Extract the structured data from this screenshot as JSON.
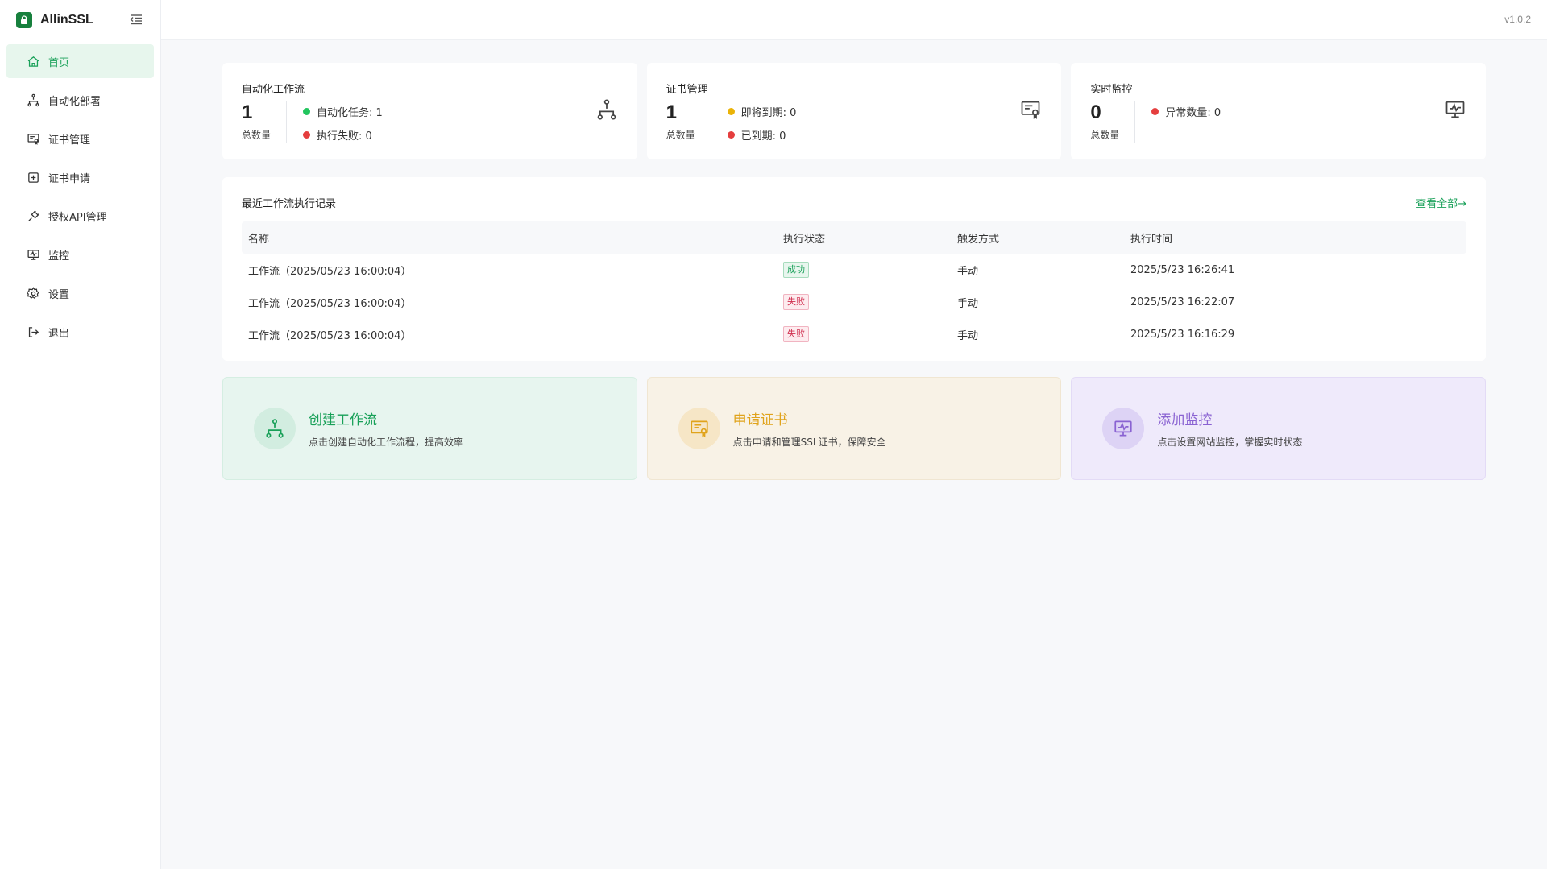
{
  "app": {
    "name": "AllinSSL",
    "version": "v1.0.2"
  },
  "sidebar": {
    "items": [
      {
        "label": "首页",
        "icon": "home-icon",
        "active": true
      },
      {
        "label": "自动化部署",
        "icon": "workflow-icon"
      },
      {
        "label": "证书管理",
        "icon": "certificate-icon"
      },
      {
        "label": "证书申请",
        "icon": "plus-square-icon"
      },
      {
        "label": "授权API管理",
        "icon": "api-plug-icon"
      },
      {
        "label": "监控",
        "icon": "monitor-icon"
      },
      {
        "label": "设置",
        "icon": "gear-icon"
      },
      {
        "label": "退出",
        "icon": "logout-icon"
      }
    ]
  },
  "stats": {
    "workflow": {
      "title": "自动化工作流",
      "count": "1",
      "count_label": "总数量",
      "items": [
        {
          "label": "自动化任务: 1",
          "color": "#22c55e"
        },
        {
          "label": "执行失败: 0",
          "color": "#e53e3e"
        }
      ]
    },
    "cert": {
      "title": "证书管理",
      "count": "1",
      "count_label": "总数量",
      "items": [
        {
          "label": "即将到期: 0",
          "color": "#eab308"
        },
        {
          "label": "已到期: 0",
          "color": "#e53e3e"
        }
      ]
    },
    "monitor": {
      "title": "实时监控",
      "count": "0",
      "count_label": "总数量",
      "items": [
        {
          "label": "异常数量: 0",
          "color": "#e53e3e"
        }
      ]
    }
  },
  "records": {
    "title": "最近工作流执行记录",
    "view_all": "查看全部→",
    "columns": [
      "名称",
      "执行状态",
      "触发方式",
      "执行时间"
    ],
    "rows": [
      {
        "name": "工作流（2025/05/23 16:00:04）",
        "status": "成功",
        "status_type": "success",
        "trigger": "手动",
        "time": "2025/5/23 16:26:41"
      },
      {
        "name": "工作流（2025/05/23 16:00:04）",
        "status": "失败",
        "status_type": "fail",
        "trigger": "手动",
        "time": "2025/5/23 16:22:07"
      },
      {
        "name": "工作流（2025/05/23 16:00:04）",
        "status": "失败",
        "status_type": "fail",
        "trigger": "手动",
        "time": "2025/5/23 16:16:29"
      }
    ]
  },
  "actions": [
    {
      "title": "创建工作流",
      "desc": "点击创建自动化工作流程，提高效率",
      "icon": "workflow-icon",
      "color": "#18a058"
    },
    {
      "title": "申请证书",
      "desc": "点击申请和管理SSL证书，保障安全",
      "icon": "certificate-icon",
      "color": "#e0a31b"
    },
    {
      "title": "添加监控",
      "desc": "点击设置网站监控，掌握实时状态",
      "icon": "monitor-icon",
      "color": "#8a63d2"
    }
  ]
}
